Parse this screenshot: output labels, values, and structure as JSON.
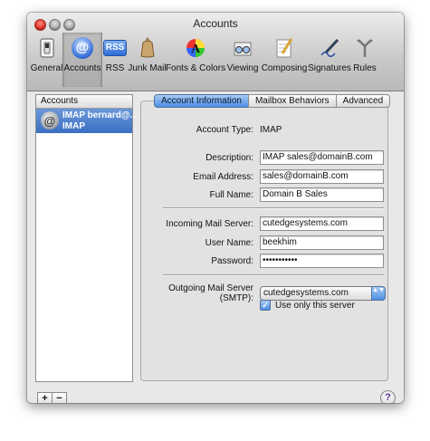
{
  "window": {
    "title": "Accounts"
  },
  "toolbar": {
    "items": [
      {
        "label": "General",
        "icon": "general-switch-icon"
      },
      {
        "label": "Accounts",
        "icon": "at-sign-icon"
      },
      {
        "label": "RSS",
        "icon": "rss-icon"
      },
      {
        "label": "Junk Mail",
        "icon": "trash-bag-icon"
      },
      {
        "label": "Fonts & Colors",
        "icon": "color-font-icon"
      },
      {
        "label": "Viewing",
        "icon": "glasses-icon"
      },
      {
        "label": "Composing",
        "icon": "pen-paper-icon"
      },
      {
        "label": "Signatures",
        "icon": "signature-pen-icon"
      },
      {
        "label": "Rules",
        "icon": "rules-arrows-icon"
      }
    ],
    "selected": "Accounts",
    "rss_text": "RSS",
    "at_text": "@"
  },
  "accounts": {
    "header": "Accounts",
    "items": [
      {
        "name": "IMAP bernard@...",
        "type": "IMAP",
        "icon_text": "@"
      }
    ],
    "add_label": "+",
    "remove_label": "−"
  },
  "tabs": [
    {
      "label": "Account Information"
    },
    {
      "label": "Mailbox Behaviors"
    },
    {
      "label": "Advanced"
    }
  ],
  "form": {
    "account_type_label": "Account Type:",
    "account_type_value": "IMAP",
    "description_label": "Description:",
    "description_value": "IMAP sales@domainB.com",
    "email_label": "Email Address:",
    "email_value": "sales@domainB.com",
    "fullname_label": "Full Name:",
    "fullname_value": "Domain B Sales",
    "incoming_label": "Incoming Mail Server:",
    "incoming_value": "cutedgesystems.com",
    "username_label": "User Name:",
    "username_value": "beekhim",
    "password_label": "Password:",
    "password_value": "•••••••••••",
    "outgoing_label": "Outgoing Mail Server (SMTP):",
    "outgoing_value": "cutedgesystems.com",
    "only_server_label": "Use only this server",
    "only_server_checked": true,
    "check_glyph": "✓",
    "select_arrows": "▲▼"
  },
  "help": {
    "label": "?"
  },
  "colors": {
    "accent": "#4b8ee4",
    "selection": "#3b6fc4"
  }
}
